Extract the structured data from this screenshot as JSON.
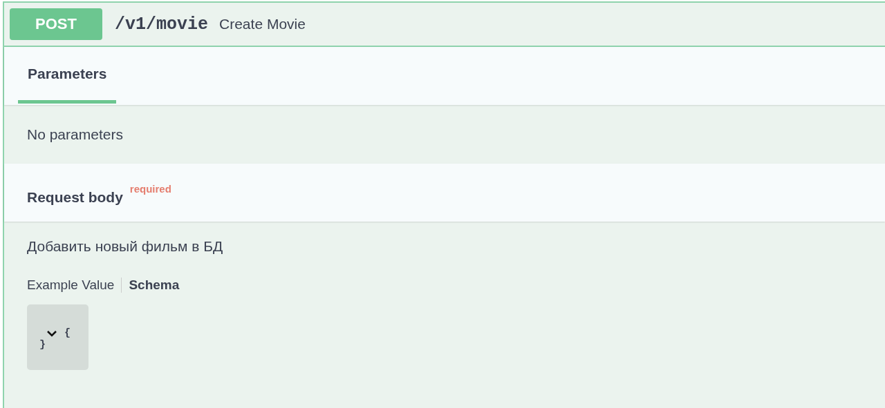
{
  "operation": {
    "method": "POST",
    "path": "/v1/movie",
    "summary": "Create Movie"
  },
  "tabs": [
    {
      "label": "Parameters",
      "selected": true
    }
  ],
  "parameters": {
    "empty_text": "No parameters"
  },
  "request_body": {
    "title": "Request body",
    "required_label": "required",
    "description": "Добавить новый фильм в БД",
    "views": [
      {
        "label": "Example Value",
        "selected": false
      },
      {
        "label": "Schema",
        "selected": true
      }
    ],
    "schema": {
      "expanded": true,
      "open_brace": "{",
      "close_brace": "}"
    }
  }
}
